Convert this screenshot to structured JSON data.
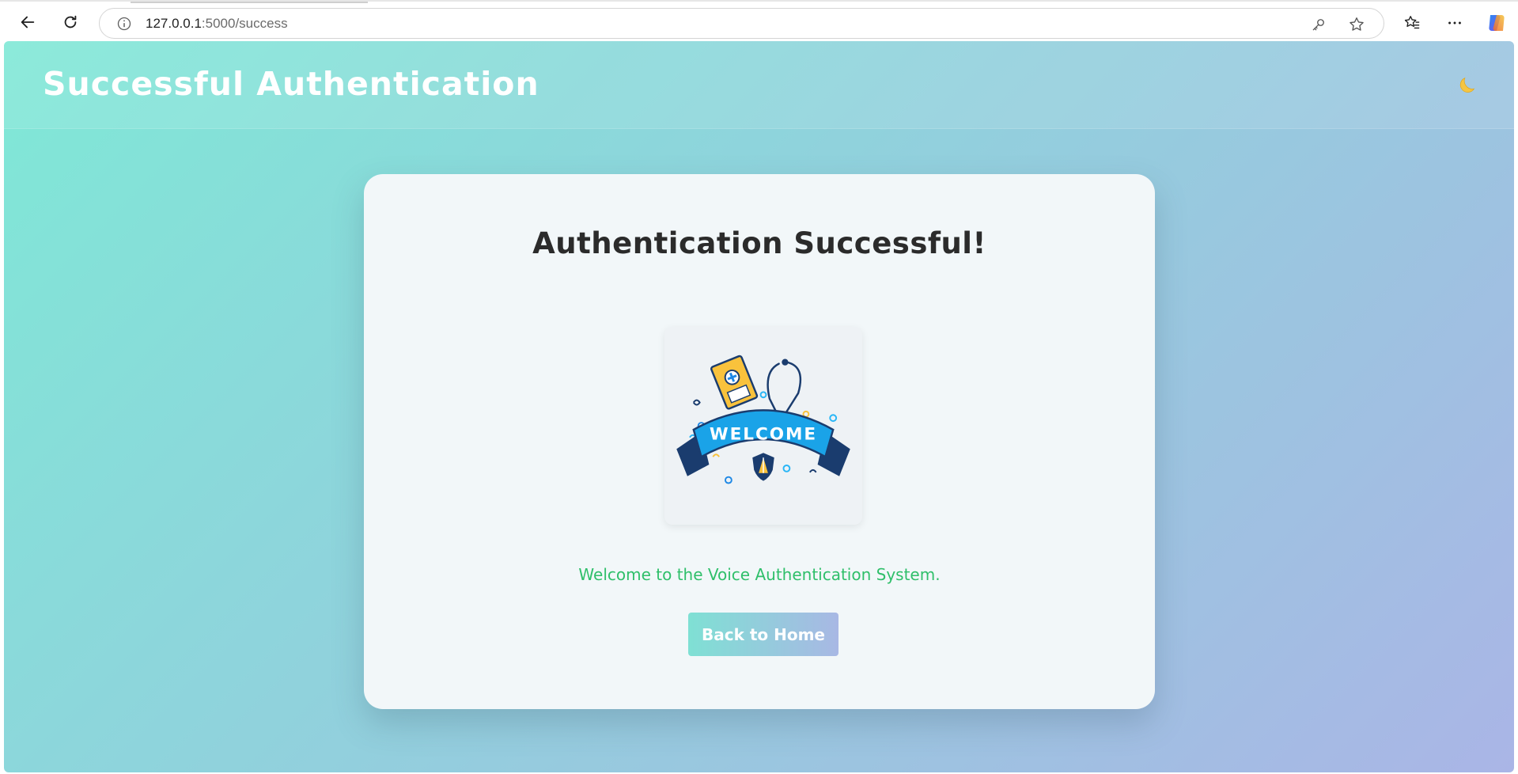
{
  "browser": {
    "url_host": "127.0.0.1",
    "url_path": ":5000/success",
    "icons": {
      "back": "back-arrow-icon",
      "reload": "reload-icon",
      "info": "info-icon",
      "key": "key-icon",
      "favorite": "star-icon",
      "favorites_list": "favorites-icon",
      "menu": "more-icon",
      "copilot": "copilot-icon"
    }
  },
  "header": {
    "title": "Successful Authentication",
    "theme_toggle_icon": "moon-icon"
  },
  "card": {
    "heading": "Authentication Successful!",
    "image_icon": "welcome-banner-image",
    "image_text": "WELCOME",
    "message": "Welcome to the Voice Authentication System.",
    "button_label": "Back to Home"
  },
  "colors": {
    "gradient_start": "#7fe8d6",
    "gradient_end": "#aab5e6",
    "card_bg": "#f2f7f9",
    "message_color": "#2fbf6a",
    "heading_color": "#2b2b2b",
    "moon_color": "#f5c542"
  }
}
